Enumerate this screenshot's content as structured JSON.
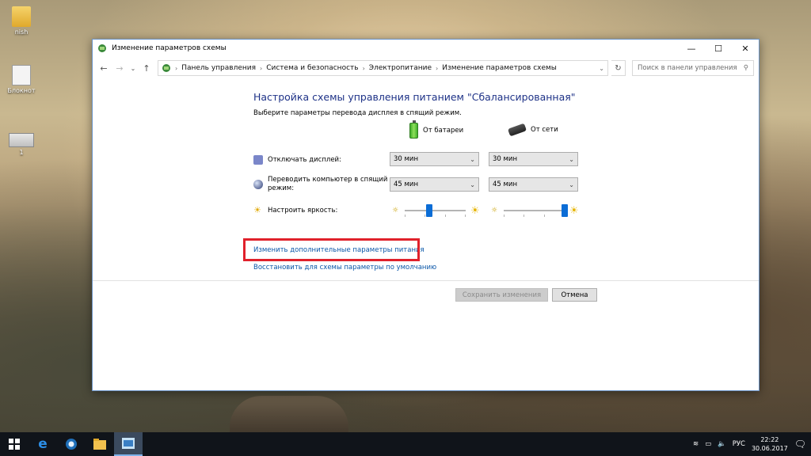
{
  "desktop": {
    "icons": [
      {
        "label": "nish",
        "kind": "folder"
      },
      {
        "label": "Блокнот",
        "kind": "notepad"
      },
      {
        "label": "1",
        "kind": "image"
      }
    ]
  },
  "window": {
    "title": "Изменение параметров схемы",
    "controls": {
      "minimize": "—",
      "maximize": "☐",
      "close": "✕"
    },
    "breadcrumbs": [
      "Панель управления",
      "Система и безопасность",
      "Электропитание",
      "Изменение параметров схемы"
    ],
    "search_placeholder": "Поиск в панели управления"
  },
  "content": {
    "heading": "Настройка схемы управления питанием \"Сбалансированная\"",
    "subtext": "Выберите параметры перевода дисплея в спящий режим.",
    "columns": {
      "battery": "От батареи",
      "power": "От сети"
    },
    "rows": {
      "display_off": {
        "label": "Отключать дисплей:",
        "battery": "30 мин",
        "power": "30 мин"
      },
      "sleep": {
        "label": "Переводить компьютер в спящий режим:",
        "battery": "45 мин",
        "power": "45 мин"
      },
      "brightness": {
        "label": "Настроить яркость:",
        "battery_level": 0.4,
        "power_level": 1.0
      }
    },
    "links": {
      "advanced": "Изменить дополнительные параметры питания",
      "restore": "Восстановить для схемы параметры по умолчанию"
    },
    "buttons": {
      "save": "Сохранить изменения",
      "cancel": "Отмена"
    }
  },
  "taskbar": {
    "language": "РУС",
    "time": "22:22",
    "date": "30.06.2017"
  },
  "colors": {
    "heading": "#1e3287",
    "link": "#0a56a8",
    "highlight": "#e0212b",
    "slider_thumb": "#0b6dd6"
  }
}
